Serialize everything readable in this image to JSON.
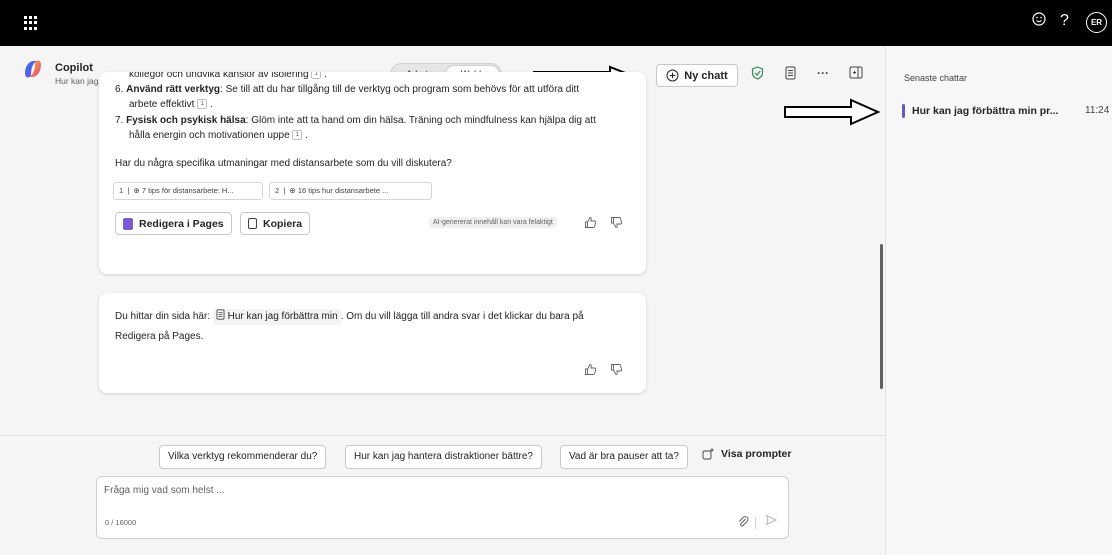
{
  "topbar": {
    "avatar_initials": "ER",
    "help_glyph": "?",
    "feedback_icon": "smiley-icon"
  },
  "app": {
    "title": "Copilot",
    "subtitle": "Hur kan jag förbättra min prod..."
  },
  "mode_toggle": {
    "options": [
      "Arbete",
      "Webb"
    ],
    "selected": "Webb"
  },
  "header": {
    "new_chat_label": "Ny chatt",
    "icons": [
      "plus-circle-icon",
      "shield-check-icon",
      "document-icon",
      "more-icon",
      "panel-icon"
    ]
  },
  "message1": {
    "partial_line": "kollegor och undvika känslor av isolering",
    "items": [
      {
        "num": "6.",
        "title": "Använd rätt verktyg",
        "text": ": Se till att du har tillgång till de verktyg och program som behövs för att utföra ditt",
        "text2": "arbete effektivt",
        "cite": "1"
      },
      {
        "num": "7.",
        "title": "Fysisk och psykisk hälsa",
        "text": ": Glöm inte att ta hand om din hälsa. Träning och mindfulness kan hjälpa dig att",
        "text2": "hålla energin och motivationen uppe",
        "cite": "1"
      }
    ],
    "question": "Har du några specifika utmaningar med distansarbete som du vill diskutera?",
    "sources": [
      {
        "num": "1",
        "label": "7 tips för distansarbete: H..."
      },
      {
        "num": "2",
        "label": "16 tips hur distansarbete ..."
      }
    ],
    "edit_pages_label": "Redigera i Pages",
    "copy_label": "Kopiera",
    "ai_disclaimer": "AI-genererat innehåll kan vara felaktigt"
  },
  "message2": {
    "prefix": "Du hittar din sida här:",
    "page_link": "Hur kan jag förbättra min",
    "suffix": ". Om du vill lägga till andra svar i det klickar du bara på",
    "line2": "Redigera på Pages."
  },
  "suggestions": [
    "Vilka verktyg rekommenderar du?",
    "Hur kan jag hantera distraktioner bättre?",
    "Vad är bra pauser att ta?"
  ],
  "visa_prompter_label": "Visa prompter",
  "input": {
    "placeholder": "Fråga mig vad som helst ...",
    "value": "",
    "counter": "0 / 16000"
  },
  "right_panel": {
    "title": "Senaste chattar",
    "recent": [
      {
        "name": "Hur kan jag förbättra min pr...",
        "time": "11:24"
      }
    ]
  },
  "colors": {
    "topbar": "#000000",
    "accent": "#5b5fc7",
    "pages_purple": "#7a5bd6",
    "shield_green": "#2e8b57"
  }
}
